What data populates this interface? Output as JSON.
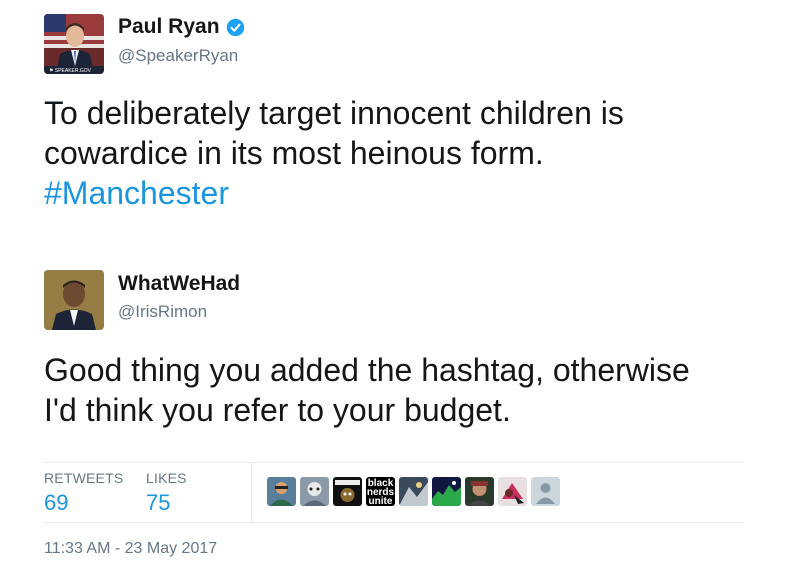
{
  "tweet1": {
    "name": "Paul Ryan",
    "handle": "@SpeakerRyan",
    "avatar_caption": "SPEAKER.GOV",
    "text_line1": "To deliberately target innocent children is",
    "text_line2": "cowardice in its most heinous form.",
    "hashtag": "#Manchester"
  },
  "tweet2": {
    "name": "WhatWeHad",
    "handle": "@IrisRimon",
    "text_line1": "Good thing you added the hashtag, otherwise",
    "text_line2": "I'd think you refer to your budget."
  },
  "stats": {
    "retweets_label": "RETWEETS",
    "retweets_value": "69",
    "likes_label": "LIKES",
    "likes_value": "75"
  },
  "likers_badge_text": "black nerds unite",
  "timestamp": "11:33 AM - 23 May 2017",
  "colors": {
    "link": "#1b95e0",
    "muted": "#657786",
    "divider": "#e6ecf0",
    "verified": "#1da1f2"
  }
}
